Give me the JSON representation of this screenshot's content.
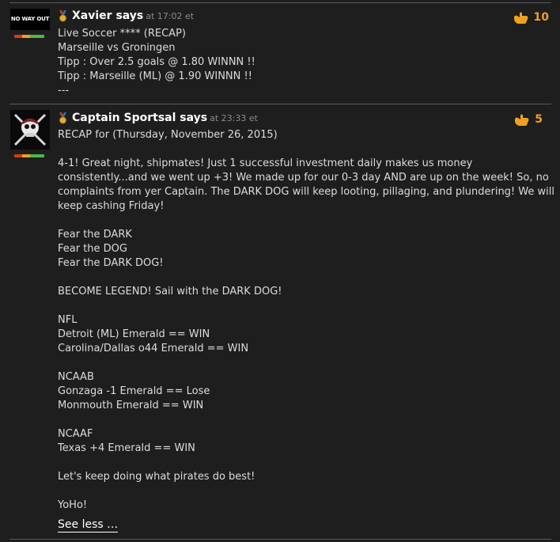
{
  "comments": [
    {
      "avatar_text": "NO WAY OUT",
      "author": "Xavier says",
      "time": "at 17:02 et",
      "likes": "10",
      "lines": [
        "Live Soccer **** (RECAP)",
        "Marseille vs Groningen",
        "Tipp : Over 2.5 goals @ 1.80 WINNN !!",
        "Tipp : Marseille (ML) @ 1.90 WINNN !!",
        "---"
      ]
    },
    {
      "author": "Captain Sportsal says",
      "time": "at 23:33 et",
      "likes": "5",
      "lines": [
        "RECAP for (Thursday, November 26, 2015)",
        "",
        "4-1! Great night, shipmates! Just 1 successful investment daily makes us money",
        "consistently...and we went up +3! We made up for our 0-3 day AND are up on the week! So, no",
        "complaints from yer Captain. The DARK DOG will keep looting, pillaging, and plundering! We will",
        "keep cashing Friday!",
        "",
        "Fear the DARK",
        "Fear the DOG",
        "Fear the DARK DOG!",
        "",
        "BECOME LEGEND! Sail with the DARK DOG!",
        "",
        "NFL",
        "Detroit (ML) Emerald == WIN",
        "Carolina/Dallas o44 Emerald == WIN",
        "",
        "NCAAB",
        "Gonzaga -1 Emerald == Lose",
        "Monmouth Emerald == WIN",
        "",
        "NCAAF",
        "Texas +4 Emerald == WIN",
        "",
        "Let's keep doing what pirates do best!",
        "",
        "YoHo!"
      ],
      "see_less": "See less …"
    }
  ],
  "colors": {
    "background": "#1e1e1e",
    "likes": "#f0a020",
    "rating_red": "#d63a1e",
    "rating_orange": "#f0a020",
    "rating_green": "#4cb848"
  }
}
